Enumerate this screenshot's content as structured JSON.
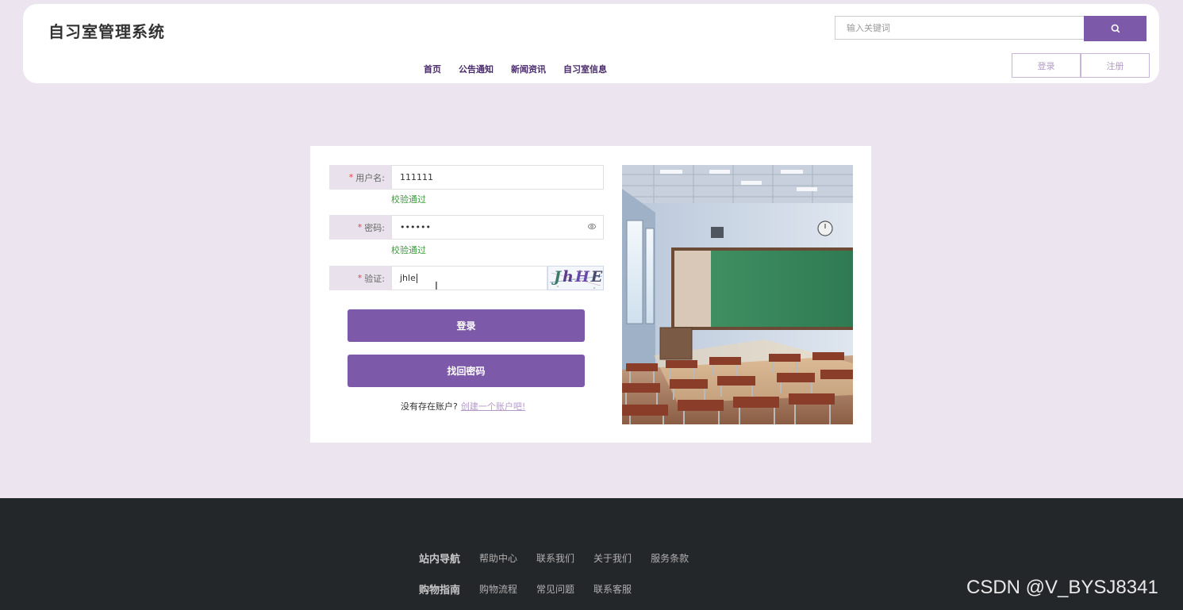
{
  "header": {
    "site_title": "自习室管理系统",
    "search_placeholder": "输入关键词",
    "nav": [
      "首页",
      "公告通知",
      "新闻资讯",
      "自习室信息"
    ],
    "login_label": "登录",
    "register_label": "注册"
  },
  "form": {
    "username_label": "用户名:",
    "username_value": "111111",
    "username_valid": "校验通过",
    "password_label": "密码:",
    "password_value": "••••••",
    "password_valid": "校验通过",
    "captcha_label": "验证:",
    "captcha_value": "jhle",
    "captcha_text": "JhHE",
    "login_button": "登录",
    "recover_button": "找回密码",
    "no_account": "没有存在账户?",
    "create_account": "创建一个账户吧!"
  },
  "footer": {
    "row1_title": "站内导航",
    "row1_links": [
      "帮助中心",
      "联系我们",
      "关于我们",
      "服务条款"
    ],
    "row2_title": "购物指南",
    "row2_links": [
      "购物流程",
      "常见问题",
      "联系客服"
    ]
  },
  "watermark": "CSDN @V_BYSJ8341",
  "colors": {
    "accent": "#7d5aa9",
    "background": "#ece4ee",
    "footer": "#24272a",
    "valid": "#3c9b3c"
  }
}
